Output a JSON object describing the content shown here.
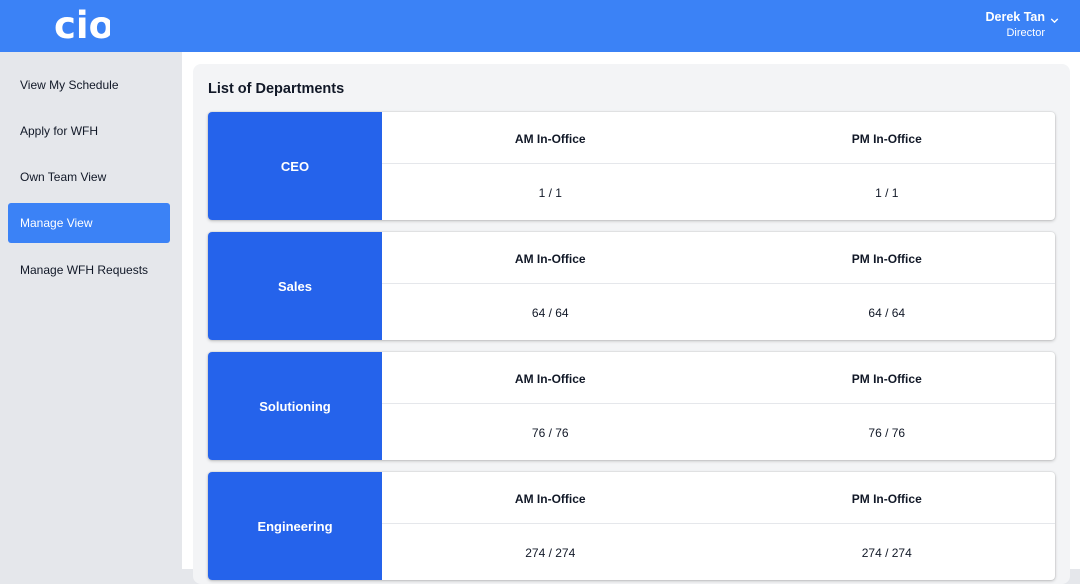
{
  "header": {
    "logo_text": "cio",
    "user_name": "Derek Tan",
    "user_role": "Director"
  },
  "sidebar": {
    "items": [
      {
        "label": "View My Schedule"
      },
      {
        "label": "Apply for WFH"
      },
      {
        "label": "Own Team View"
      },
      {
        "label": "Manage View",
        "active": true
      },
      {
        "label": "Manage WFH Requests"
      }
    ]
  },
  "main": {
    "title": "List of Departments",
    "departments": [
      {
        "name": "CEO",
        "am_label": "AM In-Office",
        "pm_label": "PM In-Office",
        "am_value": "1 / 1",
        "pm_value": "1 / 1"
      },
      {
        "name": "Sales",
        "am_label": "AM In-Office",
        "pm_label": "PM In-Office",
        "am_value": "64 / 64",
        "pm_value": "64 / 64"
      },
      {
        "name": "Solutioning",
        "am_label": "AM In-Office",
        "pm_label": "PM In-Office",
        "am_value": "76 / 76",
        "pm_value": "76 / 76"
      },
      {
        "name": "Engineering",
        "am_label": "AM In-Office",
        "pm_label": "PM In-Office",
        "am_value": "274 / 274",
        "pm_value": "274 / 274"
      }
    ]
  },
  "colors": {
    "header_bg": "#3b82f6",
    "active_nav": "#3b82f6",
    "dept_block": "#2563eb"
  }
}
